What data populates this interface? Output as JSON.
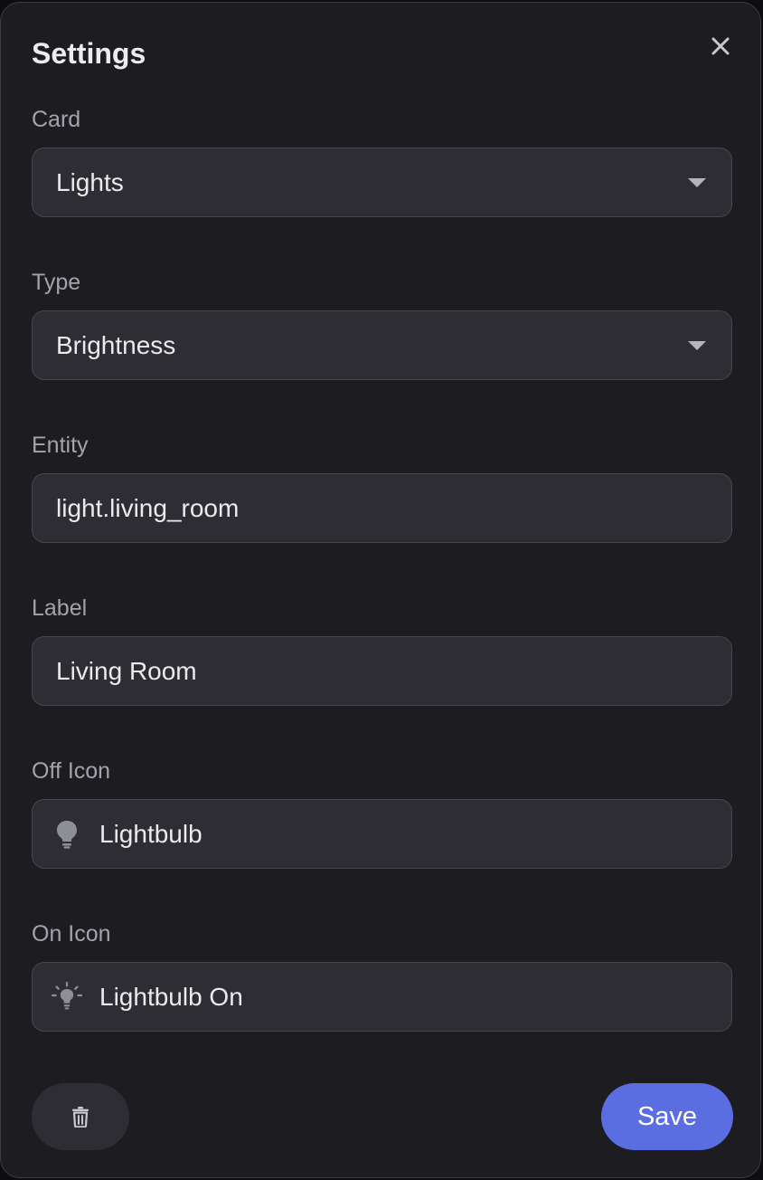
{
  "dialog": {
    "title": "Settings"
  },
  "fields": {
    "card": {
      "label": "Card",
      "value": "Lights"
    },
    "type": {
      "label": "Type",
      "value": "Brightness"
    },
    "entity": {
      "label": "Entity",
      "value": "light.living_room"
    },
    "label": {
      "label": "Label",
      "value": "Living Room"
    },
    "off_icon": {
      "label": "Off Icon",
      "value": "Lightbulb",
      "icon": "lightbulb-icon"
    },
    "on_icon": {
      "label": "On Icon",
      "value": "Lightbulb On",
      "icon": "lightbulb-on-icon"
    }
  },
  "footer": {
    "delete_icon": "trash-icon",
    "save_label": "Save"
  },
  "colors": {
    "background": "#1c1c21",
    "input_background": "#2d2d33",
    "accent": "#5b6ee1",
    "label_text": "#a3a3ab",
    "value_text": "#ebebee"
  }
}
